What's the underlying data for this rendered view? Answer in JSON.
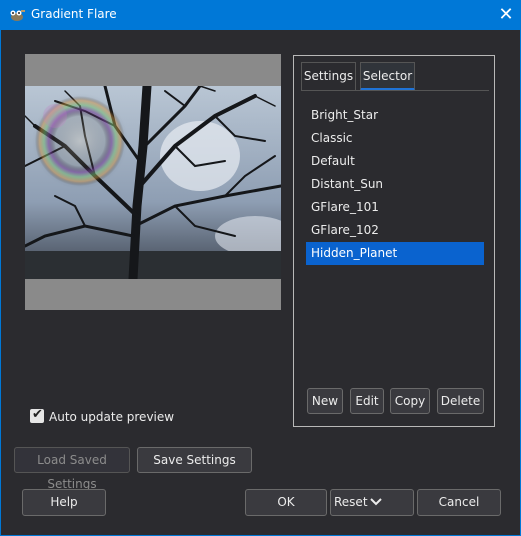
{
  "window": {
    "title": "Gradient Flare",
    "close_glyph": "✕"
  },
  "icons": {
    "app": "gimp-wilber-icon",
    "close": "close-icon",
    "check": "checkmark-icon",
    "reset_menu": "chevron-down-icon"
  },
  "colors": {
    "titlebar": "#0078d7",
    "selection": "#0a63cf",
    "background": "#2b2b2f",
    "tab_underline": "#1f74d8"
  },
  "tabs": [
    {
      "label": "Settings",
      "active": false
    },
    {
      "label": "Selector",
      "active": true
    }
  ],
  "flares": [
    "Bright_Star",
    "Classic",
    "Default",
    "Distant_Sun",
    "GFlare_101",
    "GFlare_102",
    "Hidden_Planet"
  ],
  "selected_flare": "Hidden_Planet",
  "list_buttons": {
    "new": "New",
    "edit": "Edit",
    "copy": "Copy",
    "delete": "Delete"
  },
  "auto_update": {
    "label": "Auto update preview",
    "checked": true,
    "check_glyph": "✔"
  },
  "settings_buttons": {
    "load": "Load Saved Settings",
    "save": "Save Settings"
  },
  "footer": {
    "help": "Help",
    "ok": "OK",
    "reset": "Reset",
    "reset_glyph": "⌄",
    "cancel": "Cancel"
  }
}
